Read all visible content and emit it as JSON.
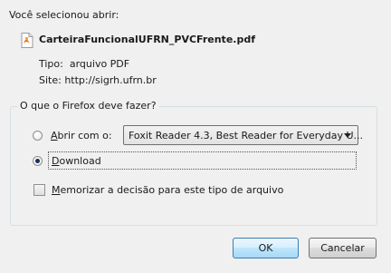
{
  "dialog": {
    "intro": "Você selecionou abrir:",
    "file_name": "CarteiraFuncionalUFRN_PVCFrente.pdf",
    "type_label": "Tipo:",
    "type_value": "arquivo PDF",
    "site_label": "Site:",
    "site_value": "http://sigrh.ufrn.br",
    "group_title": "O que o Firefox deve fazer?",
    "open_with": {
      "label_access_key": "A",
      "label_rest": "brir com o:",
      "selected_app": "Foxit Reader 4.3, Best Reader for Everyday U...",
      "checked": false
    },
    "download": {
      "label_access_key": "D",
      "label_rest": "ownload",
      "checked": true
    },
    "remember": {
      "label_access_key": "M",
      "label_rest": "emorizar a decisão para este tipo de arquivo",
      "checked": false
    },
    "buttons": {
      "ok": "OK",
      "cancel": "Cancelar"
    },
    "icons": {
      "file": "pdf-file-icon"
    }
  }
}
